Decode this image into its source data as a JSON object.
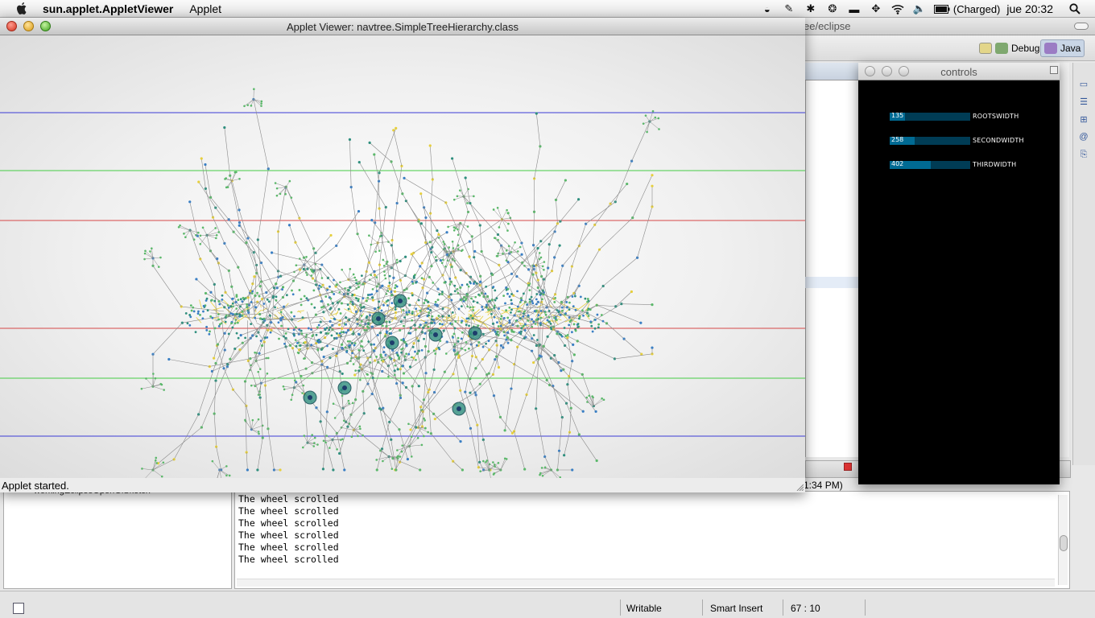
{
  "menubar": {
    "app_name": "sun.applet.AppletViewer",
    "menu_applet": "Applet",
    "battery_text": "(Charged)",
    "clock": "jue 20:32"
  },
  "eclipse": {
    "title_fragment": "ee/eclipse",
    "perspective_debug": "Debug",
    "perspective_java": "Java",
    "console_time_fragment": "1:34 PM)",
    "left_panel_label": "workingEclipseOpenGlSketch",
    "console_lines": [
      "The wheel scrolled",
      "The wheel scrolled",
      "The wheel scrolled",
      "The wheel scrolled",
      "The wheel scrolled",
      "The wheel scrolled"
    ],
    "status_writable": "Writable",
    "status_insert": "Smart Insert",
    "status_position": "67 : 10"
  },
  "applet": {
    "title": "Applet Viewer: navtree.SimpleTreeHierarchy.class",
    "status": "Applet started.",
    "guide_line_colors": [
      "#3b3bd6",
      "#45cc45",
      "#d64848"
    ],
    "tree_colors": {
      "yellow": "#e6cf3c",
      "blue": "#3a7fc4",
      "green": "#5bb86a",
      "teal": "#2f8f7e",
      "stroke": "#8a8a8a"
    }
  },
  "controls": {
    "title": "controls",
    "sliders": [
      {
        "value": "135",
        "label": "ROOTSWIDTH",
        "fraction": 0.19
      },
      {
        "value": "258",
        "label": "SECONDWIDTH",
        "fraction": 0.31
      },
      {
        "value": "402",
        "label": "THIRDWIDTH",
        "fraction": 0.51
      }
    ]
  }
}
